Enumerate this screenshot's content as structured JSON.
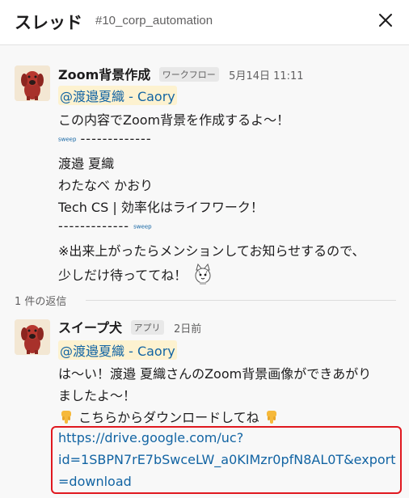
{
  "header": {
    "title": "スレッド",
    "channel": "#10_corp_automation"
  },
  "messages": [
    {
      "author": "Zoom背景作成",
      "badge": "ワークフロー",
      "time": "5月14日 11:11",
      "mention": "@渡邉夏織 - Caory",
      "lines": {
        "l1": "この内容でZoom背景を作成するよ〜！",
        "l2_tag": "sweep",
        "l2_dashes": "-------------",
        "l3": "渡邉 夏織",
        "l4": "わたなべ かおり",
        "l5": "Tech CS | 効率化はライフワーク！",
        "l6_dashes": "-------------",
        "l6_tag": "sweep",
        "l7": "※出来上がったらメンションしてお知らせするので、",
        "l8": "少しだけ待っててね！"
      }
    },
    {
      "author": "スイープ犬",
      "badge": "アプリ",
      "time": "2日前",
      "mention": "@渡邉夏織 - Caory",
      "lines": {
        "l1": "は〜い！渡邉 夏織さんのZoom背景画像ができあがり",
        "l2": "ましたよ〜！",
        "l3": "こちらからダウンロードしてね"
      },
      "link_lines": [
        "https://drive.google.com/uc?",
        "id=1SBPN7rE7bSwceLW_a0KIMzr0pfN8AL0T&export",
        "=download"
      ]
    }
  ],
  "replies": {
    "count_label": "1 件の返信"
  },
  "colors": {
    "accent_link": "#1264a3",
    "mention_bg": "#fdf2d0",
    "highlight_border": "#e0181f"
  },
  "icons": [
    "close-icon",
    "dog-avatar-icon",
    "pointing-down-icon",
    "cat-sticker-icon"
  ]
}
